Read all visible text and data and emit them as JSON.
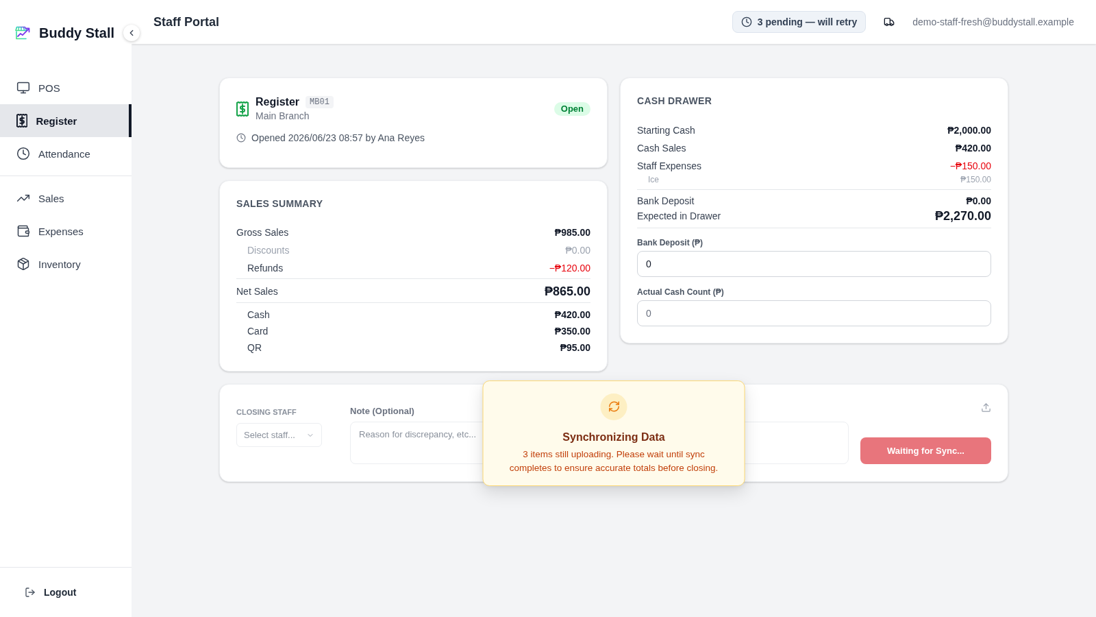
{
  "sidebar": {
    "brand": "Buddy Stall",
    "groups": [
      {
        "items": [
          {
            "label": "POS",
            "selected": false
          },
          {
            "label": "Register",
            "selected": true
          },
          {
            "label": "Attendance",
            "selected": false
          }
        ]
      },
      {
        "items": [
          {
            "label": "Sales",
            "selected": false
          },
          {
            "label": "Expenses",
            "selected": false
          },
          {
            "label": "Inventory",
            "selected": false
          }
        ]
      }
    ],
    "logout": "Logout"
  },
  "header": {
    "title": "Staff Portal",
    "sync_status": "3 pending — will retry",
    "user_email": "demo-staff-fresh@buddystall.example"
  },
  "register": {
    "title": "Register",
    "code": "MB01",
    "branch": "Main Branch",
    "status": "Open",
    "opened": "Opened 2026/06/23 08:57 by Ana Reyes"
  },
  "sales_summary": {
    "title": "SALES SUMMARY",
    "gross": {
      "label": "Gross Sales",
      "value": "₱985.00",
      "children": [
        {
          "label": "Discounts",
          "value": "₱0.00",
          "kind": "muted"
        },
        {
          "label": "Refunds",
          "value": "−₱120.00",
          "kind": "negative"
        }
      ]
    },
    "net": {
      "label": "Net Sales",
      "value": "₱865.00"
    },
    "payments": [
      {
        "label": "Cash",
        "value": "₱420.00"
      },
      {
        "label": "Card",
        "value": "₱350.00"
      },
      {
        "label": "QR",
        "value": "₱95.00"
      }
    ]
  },
  "cash_drawer": {
    "title": "CASH DRAWER",
    "lines": [
      {
        "label": "Starting Cash",
        "value": "₱2,000.00",
        "kind": "normal"
      },
      {
        "label": "Cash Sales",
        "value": "₱420.00",
        "kind": "normal"
      },
      {
        "label": "Staff Expenses",
        "value": "−₱150.00",
        "kind": "negative",
        "children": [
          {
            "label": "Ice",
            "value": "₱150.00"
          }
        ]
      }
    ],
    "totals": [
      {
        "label": "Bank Deposit",
        "value": "₱0.00",
        "kind": "normal"
      },
      {
        "label": "Expected in Drawer",
        "value": "₱2,270.00",
        "kind": "total"
      }
    ],
    "fields": [
      {
        "label": "Bank Deposit (₱)",
        "value": "0"
      },
      {
        "label": "Actual Cash Count (₱)",
        "placeholder": "0"
      }
    ]
  },
  "closing": {
    "staff_label": "CLOSING STAFF",
    "staff_placeholder": "Select staff...",
    "note_label": "Note (Optional)",
    "note_placeholder": "Reason for discrepancy, etc...",
    "submit": {
      "label": "Waiting for Sync...",
      "disabled": true
    }
  },
  "sync_dialog": {
    "title": "Synchronizing Data",
    "message": "3 items still uploading. Please wait until sync completes to ensure accurate totals before closing."
  }
}
